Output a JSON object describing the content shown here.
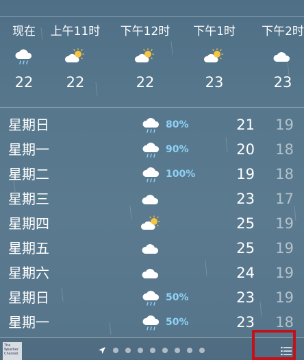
{
  "hourly": [
    {
      "label": "现在",
      "icon": "rain-cloud-icon",
      "temp": "22"
    },
    {
      "label": "上午11时",
      "icon": "sun-cloud-icon",
      "temp": "22"
    },
    {
      "label": "下午12时",
      "icon": "sun-cloud-icon",
      "temp": "22"
    },
    {
      "label": "下午1时",
      "icon": "sun-cloud-icon",
      "temp": "23"
    },
    {
      "label": "下午2时",
      "icon": "cloud-icon",
      "temp": "23"
    }
  ],
  "daily": [
    {
      "day": "星期日",
      "icon": "rain-cloud-icon",
      "precip": "80%",
      "high": "21",
      "low": "19"
    },
    {
      "day": "星期一",
      "icon": "rain-cloud-icon",
      "precip": "90%",
      "high": "20",
      "low": "18"
    },
    {
      "day": "星期二",
      "icon": "rain-cloud-icon",
      "precip": "100%",
      "high": "19",
      "low": "18"
    },
    {
      "day": "星期三",
      "icon": "cloud-icon",
      "precip": "",
      "high": "23",
      "low": "17"
    },
    {
      "day": "星期四",
      "icon": "sun-cloud-icon",
      "precip": "",
      "high": "25",
      "low": "19"
    },
    {
      "day": "星期五",
      "icon": "cloud-icon",
      "precip": "",
      "high": "25",
      "low": "19"
    },
    {
      "day": "星期六",
      "icon": "cloud-icon",
      "precip": "",
      "high": "24",
      "low": "19"
    },
    {
      "day": "星期日",
      "icon": "rain-cloud-icon",
      "precip": "50%",
      "high": "23",
      "low": "19"
    },
    {
      "day": "星期一",
      "icon": "rain-cloud-icon",
      "precip": "50%",
      "high": "23",
      "low": "18"
    }
  ],
  "footer": {
    "logo_text": "The Weather Channel",
    "page_dots": 8,
    "list_icon": "list-icon",
    "location_icon": "location-arrow-icon"
  },
  "colors": {
    "precip": "#8fd2f5",
    "highlight_box": "#c1121a",
    "sun": "#f5c542"
  }
}
